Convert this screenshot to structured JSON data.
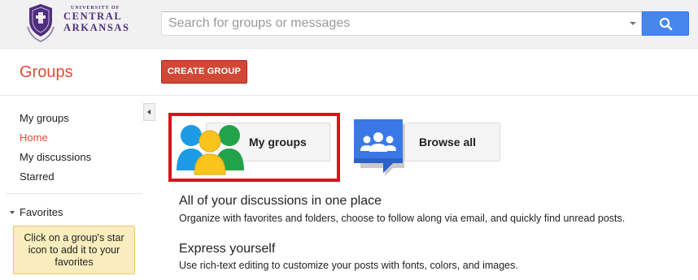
{
  "logo": {
    "line_small": "UNIVERSITY OF",
    "line_1": "CENTRAL",
    "line_2": "ARKANSAS",
    "brand_color": "#4f2d7f"
  },
  "search": {
    "placeholder": "Search for groups or messages",
    "value": "",
    "button_icon": "search-icon",
    "button_color": "#4787ed"
  },
  "header": {
    "app_title": "Groups",
    "create_label": "CREATE GROUP",
    "accent_color": "#dd4b39"
  },
  "sidebar": {
    "items": [
      {
        "label": "My groups",
        "active": false
      },
      {
        "label": "Home",
        "active": true
      },
      {
        "label": "My discussions",
        "active": false
      },
      {
        "label": "Starred",
        "active": false
      }
    ],
    "favorites_label": "Favorites",
    "favorites_tip": "Click on a group's star icon to add it to your favorites",
    "collapse_icon": "chevron-left-icon"
  },
  "tiles": {
    "my_groups": {
      "label": "My groups",
      "icon": "people-group-icon"
    },
    "browse_all": {
      "label": "Browse all",
      "icon": "browse-groups-icon"
    }
  },
  "info": [
    {
      "heading": "All of your discussions in one place",
      "text": "Organize with favorites and folders, choose to follow along via email, and quickly find unread posts."
    },
    {
      "heading": "Express yourself",
      "text": "Use rich-text editing to customize your posts with fonts, colors, and images."
    }
  ]
}
